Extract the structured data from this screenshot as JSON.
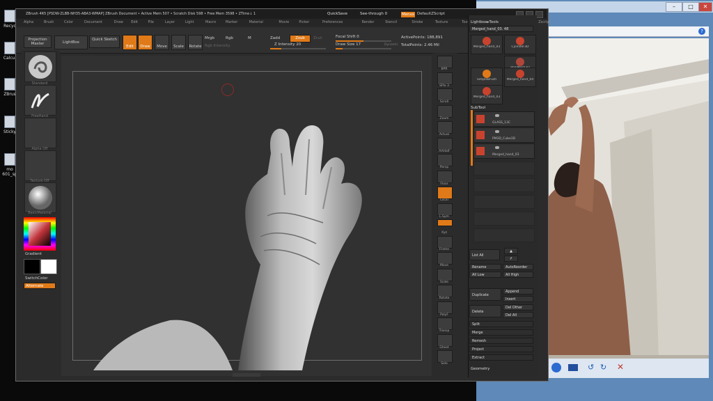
{
  "desktop": {
    "icons": [
      {
        "label": "Recyc"
      },
      {
        "label": "Calcul"
      },
      {
        "label": "ZBrus"
      },
      {
        "label": "Sticky"
      },
      {
        "label": "mo 601_sp"
      }
    ]
  },
  "zbrush": {
    "title": "ZBrush 4R5 [PSDW-ZLBB-NH35-ABA3-WMAP]   ZBrush Document   • Active Mem 507 • Scratch Disk 598 • Free Mem 3598 • ZTime↓ 1",
    "quicksave": "QuickSave",
    "seethrough": "See-through  0",
    "menus_btn": "Menus",
    "script": "DefaultZScript",
    "menus": [
      "Alpha",
      "Brush",
      "Color",
      "Document",
      "Draw",
      "Edit",
      "File",
      "Layer",
      "Light",
      "Macro",
      "Marker",
      "Material",
      "Movie",
      "Picker",
      "Preferences",
      "Render",
      "Stencil",
      "Stroke",
      "Texture",
      "Tool",
      "Transform",
      "Zplugin",
      "Zscript"
    ],
    "toolbar": {
      "projection_master": "Projection Master",
      "lightbox": "LightBox",
      "quick_sketch": "Quick Sketch",
      "edit": "Edit",
      "draw": "Draw",
      "move": "Move",
      "scale": "Scale",
      "rotate": "Rotate",
      "mrgb": "Mrgb",
      "rgb": "Rgb",
      "m": "M",
      "rgb_intensity": "Rgb Intensity",
      "zadd": "Zadd",
      "zsub": "Zsub",
      "zcut": "Zcut",
      "z_intensity": "Z Intensity 20",
      "z_intensity_value": 0.2,
      "focal_shift": "Focal Shift 0",
      "focal_shift_value": 0.5,
      "draw_size": "Draw Size 17",
      "draw_size_value": 0.12,
      "dynamic": "Dynamic",
      "active_points": "ActivePoints: 188,891",
      "total_points": "TotalPoints: 2.46 Mil"
    },
    "left_shelf": {
      "thumbs": [
        {
          "label": "Standard"
        },
        {
          "label": "FreeHand"
        },
        {
          "label": "Alpha Off"
        },
        {
          "label": "Texture Off"
        },
        {
          "label": "BasicMaterial"
        }
      ],
      "gradient": "Gradient",
      "switch_color": "SwitchColor",
      "alternate": "Alternate"
    },
    "right_shelf": [
      "BPR",
      "SPix 3",
      "Scroll",
      "Zoom",
      "Actual",
      "AAHalf",
      "Persp",
      "Floor",
      "Local",
      "L.Sym",
      "Xyz",
      "Frame",
      "Move",
      "Scale",
      "Rotate",
      "PolyF",
      "Transp",
      "Ghost",
      "Solo"
    ],
    "tray": {
      "lightbox_tools": "Lightbox▸Tools",
      "current_tool": "Merged_hand_03. 48",
      "tools": [
        "Merged_hand_03",
        "Cylinder3D",
        "PolyMesh3D",
        "SimpleBrush",
        "Merged_hand_04",
        "Merged_hand_03"
      ],
      "subtool": "SubTool",
      "subtools": [
        "GLASS_13C",
        "PM3D_Cube3D",
        "Merged_hand_03"
      ],
      "list_all": "List All",
      "rename": "Rename",
      "auto_reorder": "AutoReorder",
      "all_low": "All Low",
      "all_high": "All High",
      "duplicate": "Duplicate",
      "append": "Append",
      "insert": "Insert",
      "delete": "Delete",
      "del_other": "Del Other",
      "del_all": "Del All",
      "split": "Split",
      "merge": "Merge",
      "remesh": "Remesh",
      "project": "Project",
      "extract": "Extract",
      "geometry": "Geometry"
    }
  },
  "colors": {
    "accent": "#e07a18",
    "panel": "#2b2b2b",
    "canvas": "#313131"
  }
}
